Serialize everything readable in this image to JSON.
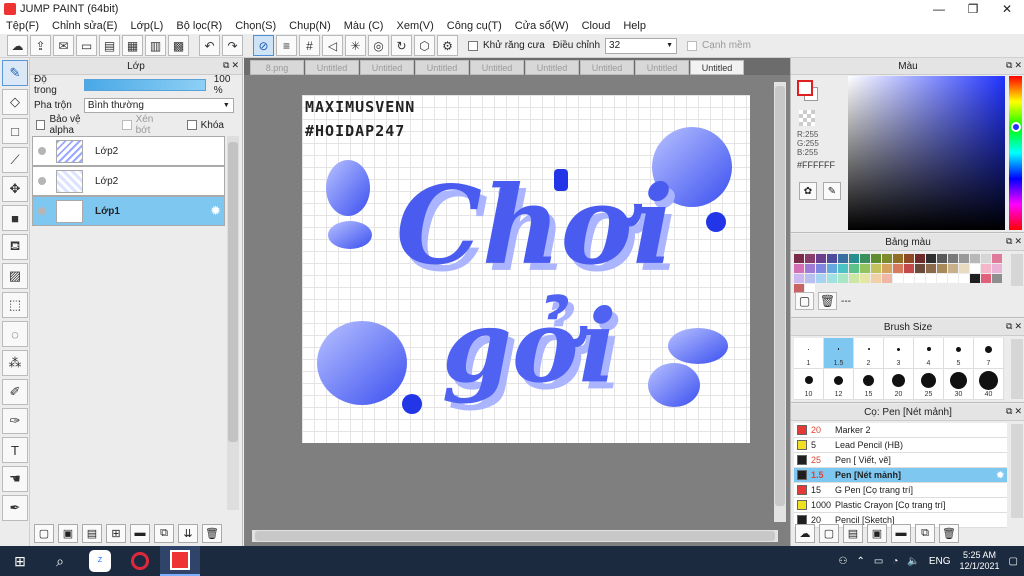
{
  "window": {
    "title": "JUMP PAINT (64bit)"
  },
  "menu": [
    "Tệp(F)",
    "Chỉnh sửa(E)",
    "Lớp(L)",
    "Bộ lọc(R)",
    "Chọn(S)",
    "Chụp(N)",
    "Màu (C)",
    "Xem(V)",
    "Công cụ(T)",
    "Cửa sổ(W)",
    "Cloud",
    "Help"
  ],
  "toolbar": {
    "antialias_label": "Khử răng cưa",
    "adjust_label": "Điều chỉnh",
    "adjust_value": "32",
    "snap_label": "Cạnh mềm"
  },
  "layer_panel": {
    "title": "Lớp",
    "opacity_label": "Độ trong",
    "opacity_value": "100 %",
    "opacity": 1.0,
    "blend_label": "Pha trộn",
    "blend_value": "Bình thường",
    "protect_alpha": "Bảo vệ alpha",
    "clip": "Xén bớt",
    "lock": "Khóa",
    "layers": [
      "Lớp2",
      "Lớp2",
      "Lớp1"
    ]
  },
  "tabs": [
    "8.png",
    "Untitled",
    "Untitled",
    "Untitled",
    "Untitled",
    "Untitled",
    "Untitled",
    "Untitled",
    "Untitled"
  ],
  "canvas": {
    "credit_line1": "MAXIMUSVENN",
    "credit_line2": "#HOIDAP247",
    "art_line1": "Chơi",
    "art_line2": "gởi"
  },
  "color_panel": {
    "title": "Màu",
    "r": "R:255",
    "g": "G:255",
    "b": "B:255",
    "hex": "#FFFFFF",
    "accent": "#2033ff"
  },
  "palette": {
    "title": "Bảng màu",
    "colors": [
      "#7b2a4a",
      "#8a3b6e",
      "#6a3e8e",
      "#4e4b9c",
      "#3a6fa1",
      "#2a8e8e",
      "#3a8f5a",
      "#5e8c2e",
      "#7d8b2a",
      "#8f6f25",
      "#8f4a25",
      "#6e2a2a",
      "#2f2f2f",
      "#5a5a5a",
      "#7a7a7a",
      "#999999",
      "#b8b8b8",
      "#d6d6d6",
      "#e07a9a",
      "#d46fb5",
      "#a07bd6",
      "#7e86e0",
      "#65a9e0",
      "#4fc3c3",
      "#5ec38a",
      "#93c35e",
      "#c3c35e",
      "#d6a35e",
      "#d67a5e",
      "#c34a4a",
      "#6a4a3a",
      "#8a6a4a",
      "#a88a5a",
      "#c8b08a",
      "#e8dcc0",
      "#ffffff",
      "#f4b6c8",
      "#eab2d6",
      "#ccb8ee",
      "#b8c0f2",
      "#a8d2f2",
      "#a0e2e2",
      "#a8e6c4",
      "#cce6a4",
      "#e6e6a4",
      "#f0d0a4",
      "#f0b8a4",
      "#ffffff",
      "#ffffff",
      "#ffffff",
      "#ffffff",
      "#ffffff",
      "#ffffff",
      "#ffffff",
      "#1f1f1f",
      "#e0607a",
      "#8e8e8e",
      "#c86464",
      "#ffffff"
    ],
    "footer_text": "---"
  },
  "brush_size": {
    "title": "Brush Size",
    "sizes": [
      "1",
      "1.5",
      "2",
      "3",
      "4",
      "5",
      "7",
      "10",
      "12",
      "15",
      "20",
      "25",
      "30",
      "40"
    ]
  },
  "brush_panel": {
    "title": "Cọ: Pen [Nét mảnh]",
    "brushes": [
      {
        "size": "20",
        "name": "Marker 2",
        "color": "#e53935"
      },
      {
        "size": "5",
        "name": "Lead Pencil (HB)",
        "color": "#f0e020"
      },
      {
        "size": "25",
        "name": "Pen [ Viết, vẽ]",
        "color": "#1f1f1f"
      },
      {
        "size": "1.5",
        "name": "Pen [Nét mảnh]",
        "color": "#1f1f1f"
      },
      {
        "size": "15",
        "name": "G Pen [Cọ trang trí]",
        "color": "#e53935"
      },
      {
        "size": "1000",
        "name": "Plastic Crayon [Cọ trang trí]",
        "color": "#f0e020"
      },
      {
        "size": "20",
        "name": "Pencil [Sketch]",
        "color": "#1f1f1f"
      }
    ]
  },
  "taskbar": {
    "lang": "ENG",
    "time": "5:25 AM",
    "date": "12/1/2021"
  }
}
